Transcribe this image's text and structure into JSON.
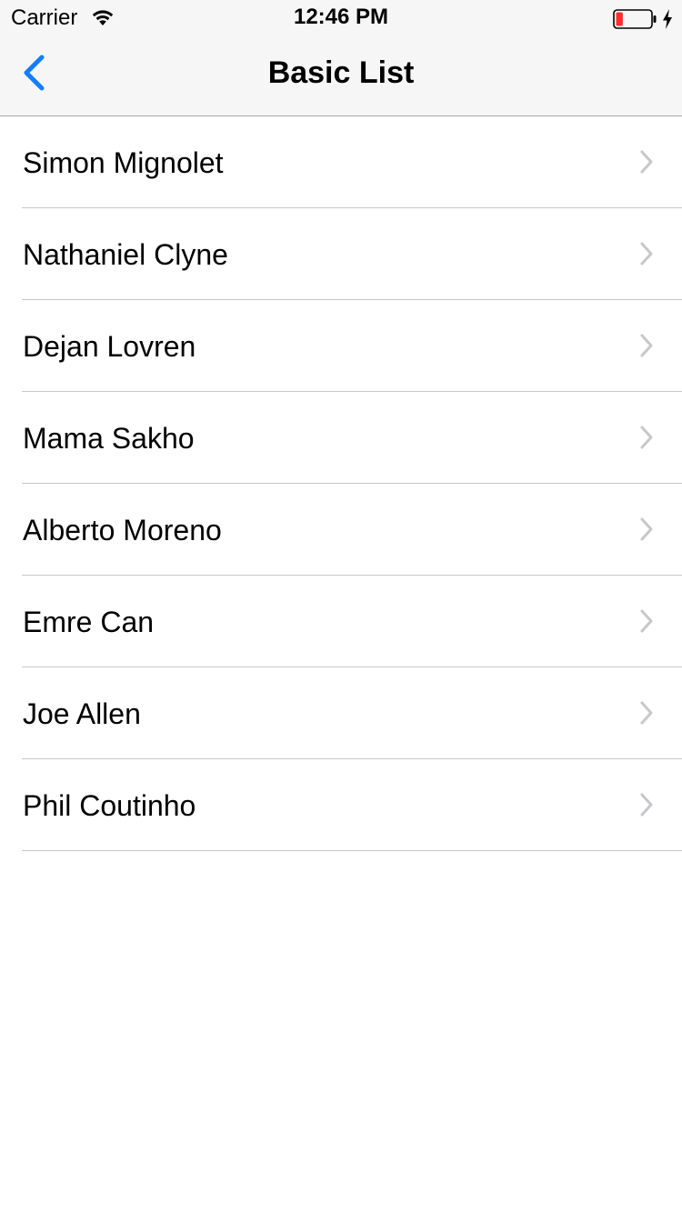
{
  "status_bar": {
    "carrier": "Carrier",
    "time": "12:46 PM",
    "battery_level": 0.2,
    "charging": true
  },
  "nav_bar": {
    "title": "Basic List",
    "back_icon": "chevron-left-icon"
  },
  "list": {
    "items": [
      {
        "label": "Simon Mignolet"
      },
      {
        "label": "Nathaniel Clyne"
      },
      {
        "label": "Dejan Lovren"
      },
      {
        "label": "Mama Sakho"
      },
      {
        "label": "Alberto Moreno"
      },
      {
        "label": "Emre Can"
      },
      {
        "label": "Joe Allen"
      },
      {
        "label": "Phil Coutinho"
      }
    ]
  },
  "colors": {
    "accent": "#147efb",
    "chevron": "#c7c7cc",
    "separator": "#c8c7cc",
    "nav_background": "#f6f6f6",
    "battery_low": "#ff2d2d"
  }
}
